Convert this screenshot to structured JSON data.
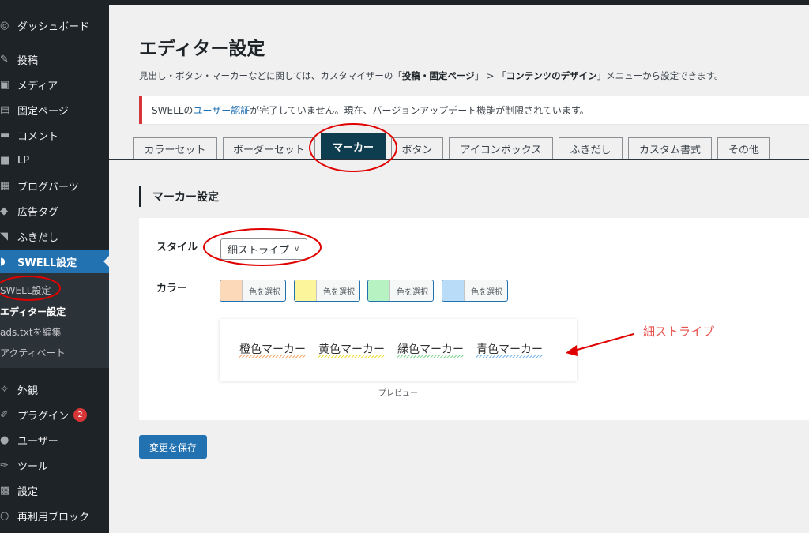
{
  "sidebar": {
    "items": [
      {
        "icon": "dashboard-icon",
        "glyph": "◎",
        "label": "ダッシュボード"
      },
      {
        "icon": "pin-icon",
        "glyph": "✎",
        "label": "投稿"
      },
      {
        "icon": "media-icon",
        "glyph": "▣",
        "label": "メディア"
      },
      {
        "icon": "page-icon",
        "glyph": "▤",
        "label": "固定ページ"
      },
      {
        "icon": "comment-icon",
        "glyph": "▬",
        "label": "コメント"
      },
      {
        "icon": "lp-icon",
        "glyph": "■",
        "label": "LP"
      },
      {
        "icon": "blog-parts-icon",
        "glyph": "▦",
        "label": "ブログパーツ"
      },
      {
        "icon": "ad-tag-icon",
        "glyph": "◆",
        "label": "広告タグ"
      },
      {
        "icon": "balloon-icon",
        "glyph": "◥",
        "label": "ふきだし"
      },
      {
        "icon": "swell-icon",
        "glyph": "◗",
        "label": "SWELL設定"
      },
      {
        "icon": "appearance-icon",
        "glyph": "✧",
        "label": "外観"
      },
      {
        "icon": "plugin-icon",
        "glyph": "✐",
        "label": "プラグイン",
        "badge": "2"
      },
      {
        "icon": "user-icon",
        "glyph": "●",
        "label": "ユーザー"
      },
      {
        "icon": "tool-icon",
        "glyph": "✑",
        "label": "ツール"
      },
      {
        "icon": "settings-icon",
        "glyph": "▩",
        "label": "設定"
      },
      {
        "icon": "reusable-block-icon",
        "glyph": "○",
        "label": "再利用ブロック"
      }
    ],
    "submenu": [
      {
        "label": "SWELL設定"
      },
      {
        "label": "エディター設定"
      },
      {
        "label": "ads.txtを編集"
      },
      {
        "label": "アクティベート"
      }
    ]
  },
  "page": {
    "title": "エディター設定",
    "desc_pre": "見出し・ボタン・マーカーなどに関しては、カスタマイザーの「",
    "desc_bold1": "投稿・固定ページ",
    "desc_mid": "」 > 「",
    "desc_bold2": "コンテンツのデザイン",
    "desc_post": "」メニューから設定できます。"
  },
  "notice": {
    "pre": "SWELLの",
    "link": "ユーザー認証",
    "post": "が完了していません。現在、バージョンアップデート機能が制限されています。"
  },
  "tabs": [
    {
      "label": "カラーセット"
    },
    {
      "label": "ボーダーセット"
    },
    {
      "label": "マーカー"
    },
    {
      "label": "ボタン"
    },
    {
      "label": "アイコンボックス"
    },
    {
      "label": "ふきだし"
    },
    {
      "label": "カスタム書式"
    },
    {
      "label": "その他"
    }
  ],
  "section": {
    "title": "マーカー設定"
  },
  "form": {
    "style_label": "スタイル",
    "style_value": "細ストライプ",
    "color_label": "カラー",
    "colors": [
      {
        "swatch": "#fcd9b8",
        "label": "色を選択"
      },
      {
        "swatch": "#fdf59b",
        "label": "色を選択"
      },
      {
        "swatch": "#b7f2c2",
        "label": "色を選択"
      },
      {
        "swatch": "#b9dcf8",
        "label": "色を選択"
      }
    ]
  },
  "preview": {
    "markers": [
      {
        "label": "橙色マーカー",
        "color": "#f9a86b"
      },
      {
        "label": "黄色マーカー",
        "color": "#f3de3a"
      },
      {
        "label": "緑色マーカー",
        "color": "#7fd88f"
      },
      {
        "label": "青色マーカー",
        "color": "#7bb8ee"
      }
    ],
    "caption": "プレビュー"
  },
  "save_label": "変更を保存",
  "annotation": {
    "text": "細ストライプ",
    "color": "#e8524f"
  },
  "colors": {
    "sidebar_bg": "#1d2327",
    "accent": "#2271b1",
    "active_tab": "#0f3d50",
    "annotation_red": "#e00000"
  }
}
